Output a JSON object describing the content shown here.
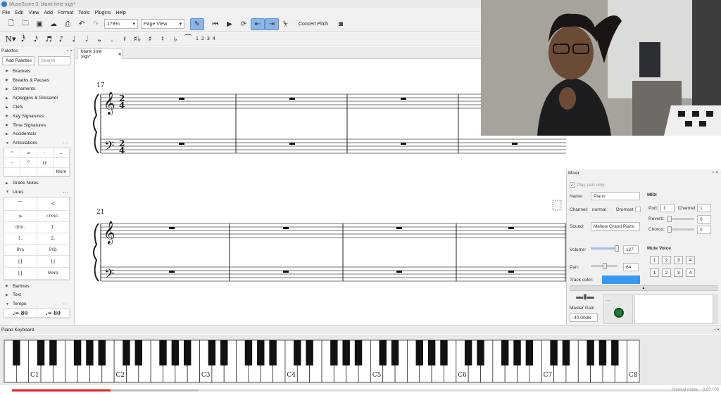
{
  "window": {
    "title": "MuseScore 3: blank time sigs*"
  },
  "menu": [
    "File",
    "Edit",
    "View",
    "Add",
    "Format",
    "Tools",
    "Plugins",
    "Help"
  ],
  "toolbar": {
    "zoom": "178%",
    "view_mode": "Page View",
    "concert_pitch": "Concert Pitch"
  },
  "note_input": {
    "voices": [
      "1",
      "2",
      "3",
      "4"
    ]
  },
  "palettes": {
    "title": "Palettes",
    "add_button": "Add Palettes",
    "search_placeholder": "Search",
    "items_top": [
      "Brackets",
      "Breaths & Pauses",
      "Ornaments",
      "Arpeggios & Glissandi",
      "Clefs",
      "Key Signatures",
      "Time Signatures",
      "Accidentals"
    ],
    "articulations": {
      "label": "Articulations",
      "more": "More"
    },
    "grace_notes": "Grace Notes",
    "lines": {
      "label": "Lines",
      "more": "More",
      "cells": [
        "",
        "",
        "",
        "cresc.",
        "dim.",
        "1.",
        "1.",
        "2.",
        "8va",
        "8vb",
        "",
        ""
      ]
    },
    "items_bottom": [
      "Barlines",
      "Text"
    ],
    "tempo": {
      "label": "Tempo",
      "cells": [
        "♩= 80",
        "♩= 80"
      ]
    }
  },
  "score": {
    "tab_label": "blank time sigs*",
    "tab_close": "✕",
    "system1_measure": "17",
    "system2_measure": "21",
    "time_sig_top": "2",
    "time_sig_bottom": "4"
  },
  "mixer": {
    "title": "Mixer",
    "play_part_only": "Play part only",
    "name_label": "Name:",
    "name_value": "Piano",
    "channel_label": "Channel:",
    "channel_value": "normal",
    "drumset_label": "Drumset",
    "sound_label": "Sound:",
    "sound_value": "Mellow Grand Piano",
    "midi_label": "MIDI",
    "port_label": "Port:",
    "port_value": "1",
    "channel_num_label": "Channel:",
    "channel_num_value": "1",
    "reverb_label": "Reverb:",
    "reverb_value": "0",
    "chorus_label": "Chorus:",
    "chorus_value": "0",
    "volume_label": "Volume:",
    "volume_value": "127",
    "pan_label": "Pan:",
    "pan_value": "64",
    "mute_voice_label": "Mute Voice",
    "mute_voices": [
      "1",
      "2",
      "3",
      "4"
    ],
    "track_color_label": "Track color:",
    "track_color": "#3a97f0",
    "master_gain_label": "Master Gain",
    "master_gain_value": "-40.00dB"
  },
  "piano_keyboard": {
    "title": "Piano Keyboard",
    "octave_labels": [
      "C1",
      "C2",
      "C3",
      "C4",
      "C5",
      "C6",
      "C7",
      "C8"
    ]
  },
  "video": {
    "progress": 0.155,
    "mode_text": "Normal mode",
    "time_text": "0:03:000"
  }
}
